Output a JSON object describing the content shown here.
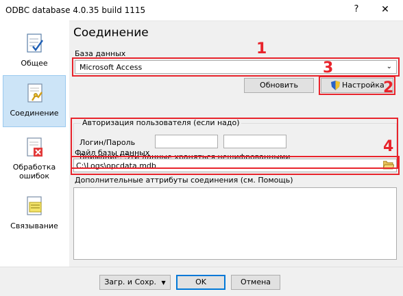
{
  "window": {
    "title": "ODBC database 4.0.35 build 1115",
    "help_glyph": "?",
    "close_glyph": "✕"
  },
  "sidebar": {
    "items": [
      {
        "label": "Общее",
        "icon": "checklist-icon"
      },
      {
        "label": "Соединение",
        "icon": "connection-icon"
      },
      {
        "label": "Обработка\nошибок",
        "icon": "error-handling-icon"
      },
      {
        "label": "Связывание",
        "icon": "binding-icon"
      }
    ]
  },
  "main": {
    "heading": "Соединение",
    "database_label": "База данных",
    "database_value": "Microsoft Access",
    "refresh_label": "Обновить",
    "setup_label": "Настройка",
    "auth": {
      "title": "Авторизация пользователя (если надо)",
      "login_label": "Логин/Пароль",
      "login_value": "",
      "password_value": "",
      "warning": "Внимание! Эти данные храняться нешифрованными"
    },
    "file_label": "Файл базы данных",
    "file_value": "C:\\Logs\\opcdata.mdb",
    "attrs_label": "Дополнительные аттрибуты соединения (см. Помощь)",
    "attrs_value": ""
  },
  "annotations": [
    "1",
    "2",
    "3",
    "4"
  ],
  "footer": {
    "load_save_label": "Загр. и Сохр.",
    "ok_label": "OK",
    "cancel_label": "Отмена"
  },
  "colors": {
    "annotation_red": "#e8232b",
    "selected_nav": "#cce4f7",
    "ok_border": "#0078d7"
  }
}
